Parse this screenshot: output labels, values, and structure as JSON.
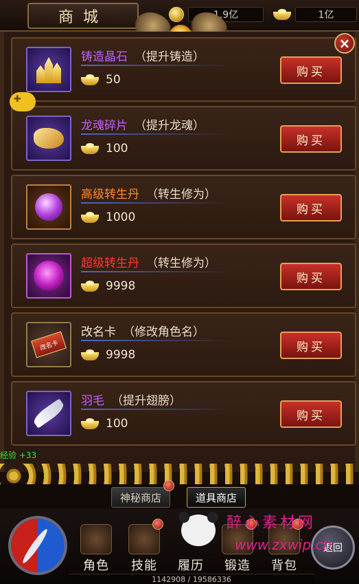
{
  "header": {
    "title": "商城",
    "coin_amount": "1.9亿",
    "ingot_amount": "1亿",
    "close_label": "×"
  },
  "items": [
    {
      "name": "铸造晶石",
      "desc": "（提升铸造）",
      "name_color": "#c060ff",
      "price": "50",
      "buy_label": "购买",
      "icon": "crystal-icon"
    },
    {
      "name": "龙魂碎片",
      "desc": "（提升龙魂）",
      "name_color": "#c060ff",
      "price": "100",
      "buy_label": "购买",
      "icon": "dragon-fragment-icon"
    },
    {
      "name": "高级转生丹",
      "desc": "（转生修为）",
      "name_color": "#ff8a2a",
      "price": "1000",
      "buy_label": "购买",
      "icon": "purple-pill-icon"
    },
    {
      "name": "超级转生丹",
      "desc": "（转生修为）",
      "name_color": "#ff3a2a",
      "price": "9998",
      "buy_label": "购买",
      "icon": "magenta-pill-icon"
    },
    {
      "name": "改名卡",
      "desc": "（修改角色名）",
      "name_color": "#f0e6d2",
      "price": "9998",
      "buy_label": "购买",
      "icon": "rename-card-icon",
      "card_text": "改名卡"
    },
    {
      "name": "羽毛",
      "desc": "（提升翅膀）",
      "name_color": "#c060ff",
      "price": "100",
      "buy_label": "购买",
      "icon": "feather-icon"
    }
  ],
  "exp_text": "经验 +33",
  "shop_tabs": {
    "mystery": "神秘商店",
    "items": "道具商店",
    "active": "items"
  },
  "menu": {
    "role": "角色",
    "skill": "技能",
    "history": "履历",
    "forge": "锻造",
    "bag": "背包",
    "return": "返回"
  },
  "watermark": {
    "text": "醉心素材网",
    "url": "www.zxwip.cn"
  },
  "xp_readout": "1142908 / 19586336",
  "colors": {
    "buy_button": "#b8241c",
    "accent_gold": "#e8c060",
    "frame": "#6a4526"
  }
}
